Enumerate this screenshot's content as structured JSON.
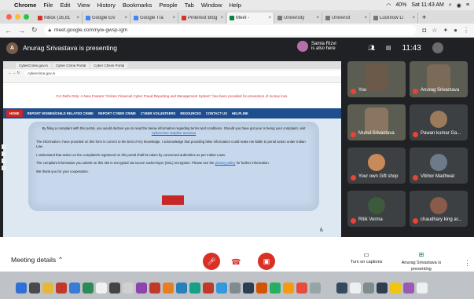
{
  "menubar": {
    "apple": "",
    "items": [
      "Chrome",
      "File",
      "Edit",
      "View",
      "History",
      "Bookmarks",
      "People",
      "Tab",
      "Window",
      "Help"
    ],
    "battery": "40%",
    "clock": "Sat 11:43 AM"
  },
  "tabs": [
    {
      "label": "Inbox (16,81",
      "color": "#d93025"
    },
    {
      "label": "Google Elv",
      "color": "#4285f4"
    },
    {
      "label": "Google Tra",
      "color": "#4285f4"
    },
    {
      "label": "Pinterest Blog",
      "color": "#d93025"
    },
    {
      "label": "Meet -",
      "color": "#0b8043",
      "active": true
    },
    {
      "label": "University",
      "color": "#777777"
    },
    {
      "label": "Universit",
      "color": "#777777"
    },
    {
      "label": "Lucknow Li",
      "color": "#777777"
    }
  ],
  "address": {
    "url": "meet.google.com/nyw-gwsp-igm"
  },
  "meet": {
    "presenter_initial": "A",
    "presenter_text": "Anurag Srivastava is presenting",
    "also_name": "Samia Rizvi",
    "also_text": "is also here",
    "time": "11:43"
  },
  "shared": {
    "tabs": [
      "CyberCrime.gov.in",
      "Cyber Crime Portal",
      "Cyber Check Portal"
    ],
    "url": "cybercrime.gov.in",
    "headline": "For Delhi Only: A New Feature \"Citizen Financial Cyber Fraud Reporting and Management System\" has been provided for prevention of money loss.",
    "nav": [
      "HOME",
      "REPORT WOMEN/CHILD RELATED CRIME",
      "REPORT CYBER CRIME",
      "CYBER VOLUNTEERS",
      "RESOURCES",
      "CONTACT US",
      "HELPLINE"
    ],
    "dialog_p1": "By filing a complaint with this portal, you would declare you to read the below information regarding terms and conditions. Should you have got your is being your complaint, visit",
    "dialog_link1": "Cybercrime Helpline Services",
    "dialog_p2": "The information I have provided on this form is correct to the best of my knowledge. I acknowledge that providing false information could make me liable to penal action under Indian Law.",
    "dialog_p3": "I understand that action on the complaint/s registered on this portal shall be taken by concerned authorities as per Indian Laws.",
    "dialog_p4": "The complaint information you submit on this site is encrypted via secure socket layer (SSL) encryption. Please see the",
    "dialog_link2": "privacy policy",
    "dialog_p4b": "for further information.",
    "dialog_p5": "We thank you for your cooperation."
  },
  "participants": [
    {
      "name": "You",
      "color": "#6b5a4a",
      "video": true
    },
    {
      "name": "Anurag Srivastava",
      "color": "#7b6a58",
      "video": true
    },
    {
      "name": "Mukul Srivastava",
      "color": "#8a7560",
      "video": true
    },
    {
      "name": "Pawan kumar Ga...",
      "color": "#9b7b5b",
      "video": false
    },
    {
      "name": "Your own Gift shop",
      "color": "#c98a5a",
      "video": false
    },
    {
      "name": "Vibhor Madhwal",
      "color": "#6d7a8a",
      "video": false
    },
    {
      "name": "Ritik Verma",
      "color": "#3d5a3d",
      "video": false
    },
    {
      "name": "chaudhary king ar...",
      "color": "#8a5a4a",
      "video": false
    }
  ],
  "bottom": {
    "meeting_details": "Meeting details",
    "captions": "Turn on captions",
    "presenting": "Anurag Srivastava is presenting"
  },
  "dock": {
    "colors": [
      "#2f6fd6",
      "#4a4a4a",
      "#e5b83a",
      "#c0392b",
      "#3a7bd5",
      "#2e8b57",
      "#f0f0f0",
      "#444444",
      "#d0d0d0",
      "#8e44ad",
      "#c0392b",
      "#e67e22",
      "#2980b9",
      "#16a085",
      "#c0392b",
      "#3498db",
      "#7f8c8d",
      "#2c3e50",
      "#d35400",
      "#27ae60",
      "#f39c12",
      "#e74c3c",
      "#95a5a6",
      "#bdc3c7",
      "#34495e",
      "#ecf0f1",
      "#7f8c8d",
      "#2c3e50",
      "#f1c40f",
      "#9b59b6",
      "#ecf0f1",
      "#bdc3c7"
    ]
  }
}
